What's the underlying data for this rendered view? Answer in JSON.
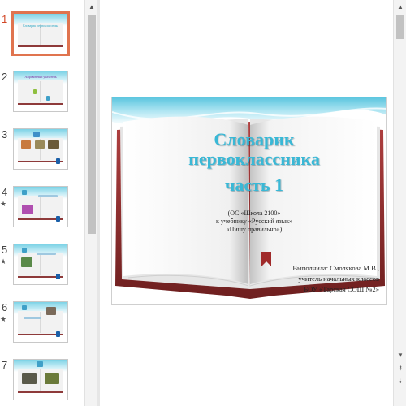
{
  "thumbnails": [
    {
      "number": "1",
      "active": true,
      "star": "",
      "title": "Словарик первоклассника"
    },
    {
      "number": "2",
      "active": false,
      "star": "",
      "title": "Алфавитный указатель"
    },
    {
      "number": "3",
      "active": false,
      "star": "",
      "title": ""
    },
    {
      "number": "4",
      "active": false,
      "star": "★",
      "title": ""
    },
    {
      "number": "5",
      "active": false,
      "star": "★",
      "title": ""
    },
    {
      "number": "6",
      "active": false,
      "star": "★",
      "title": ""
    },
    {
      "number": "7",
      "active": false,
      "star": "",
      "title": ""
    }
  ],
  "slide": {
    "title_lines": [
      "Словарик",
      "первоклассника",
      "часть 1"
    ],
    "subtitle_lines": [
      "(ОС «Школа 2100»",
      "к учебнику «Русский язык»",
      "«Пишу правильно»)"
    ],
    "author_lines": [
      "Выполнила: Смолякова М.В.,",
      "учитель начальных классов",
      "БОУ «Тарская СОШ №2»"
    ]
  },
  "scrollbar_glyphs": {
    "up": "▲",
    "down": "▼",
    "prev_slide": "⯭",
    "next_slide": "⯯"
  },
  "colors": {
    "accent_title": "#39b8d6",
    "active_border": "#e0744f",
    "book_cover": "#8e2f2f",
    "wave": "#6fcde3"
  }
}
